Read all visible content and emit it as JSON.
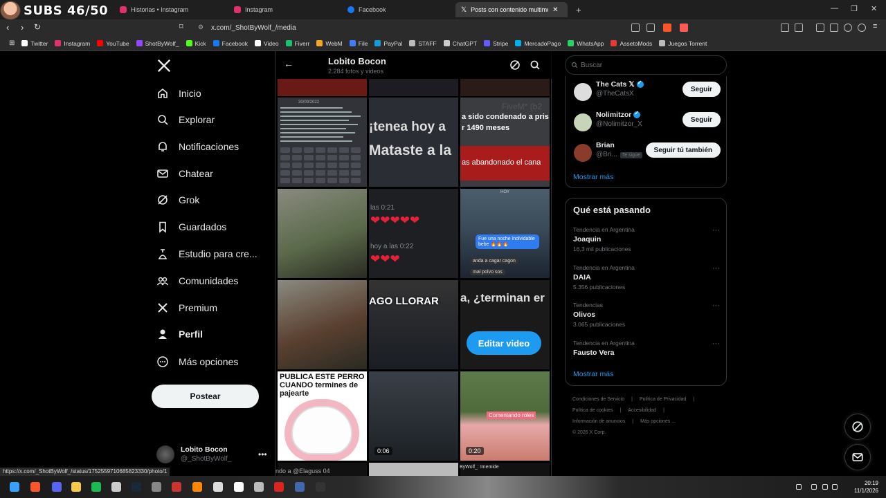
{
  "overlay": {
    "subs": "SUBS 46/50"
  },
  "tabs": [
    {
      "label": "Historias • Instagram",
      "color": "#e1306c"
    },
    {
      "label": "Instagram",
      "color": "#e1306c"
    },
    {
      "label": "Facebook",
      "color": "#1877f2"
    },
    {
      "label": "Posts con contenido multimedia",
      "color": "#ffffff"
    }
  ],
  "address": {
    "url": "x.com/_ShotByWolf_/media"
  },
  "bookmarks": [
    {
      "label": "Twitter",
      "color": "#ffffff"
    },
    {
      "label": "Instagram",
      "color": "#e1306c"
    },
    {
      "label": "YouTube",
      "color": "#ff0000"
    },
    {
      "label": "ShotByWolf_",
      "color": "#9146ff"
    },
    {
      "label": "Kick",
      "color": "#53fc18"
    },
    {
      "label": "Facebook",
      "color": "#1877f2"
    },
    {
      "label": "Video",
      "color": "#ffffff"
    },
    {
      "label": "Fiverr",
      "color": "#1dbf73"
    },
    {
      "label": "WebM",
      "color": "#f5a623"
    },
    {
      "label": "File",
      "color": "#3f7cf6"
    },
    {
      "label": "PayPal",
      "color": "#169bd7"
    },
    {
      "label": "STAFF",
      "color": "#bbbbbb"
    },
    {
      "label": "ChatGPT",
      "color": "#cccccc"
    },
    {
      "label": "Stripe",
      "color": "#635bff"
    },
    {
      "label": "MercadoPago",
      "color": "#00b1ea"
    },
    {
      "label": "WhatsApp",
      "color": "#25d366"
    },
    {
      "label": "AssetoMods",
      "color": "#e53935"
    },
    {
      "label": "Juegos Torrent",
      "color": "#bbbbbb"
    }
  ],
  "nav": {
    "items": [
      {
        "label": "Inicio",
        "icon": "home-icon"
      },
      {
        "label": "Explorar",
        "icon": "search-icon"
      },
      {
        "label": "Notificaciones",
        "icon": "bell-icon"
      },
      {
        "label": "Chatear",
        "icon": "mail-icon"
      },
      {
        "label": "Grok",
        "icon": "grok-icon"
      },
      {
        "label": "Guardados",
        "icon": "bookmark-icon"
      },
      {
        "label": "Estudio para cre...",
        "icon": "studio-icon"
      },
      {
        "label": "Comunidades",
        "icon": "communities-icon"
      },
      {
        "label": "Premium",
        "icon": "x-icon"
      },
      {
        "label": "Perfil",
        "icon": "profile-icon"
      },
      {
        "label": "Más opciones",
        "icon": "more-icon"
      }
    ],
    "post_label": "Postear",
    "account": {
      "name": "Lobito Bocon",
      "handle": "@_ShotByWolf_"
    }
  },
  "main": {
    "title": "Lobito Bocon",
    "subtitle": "2.284 fotos y videos",
    "tiles": [
      {
        "kind": "discord-msg",
        "date": "30/09/2022"
      },
      {
        "kind": "text",
        "text": "¡tenea   hoy a",
        "text2": "Mataste a la"
      },
      {
        "kind": "text-red",
        "text": "a sido condenado a pris",
        "text2": "r 1490 meses",
        "text3": "as abandonado el cana",
        "top": "FiveM* (b2"
      },
      {
        "kind": "photo",
        "bg": "#5a6a4a"
      },
      {
        "kind": "chat",
        "text": "las 0:21",
        "text2": "hoy a las 0:22"
      },
      {
        "kind": "game-chat",
        "bubble": "Fue una noche inolvidable bebe 🔥🔥🔥",
        "l1": "anda a cagar cagon",
        "l2": "mal polvo sos",
        "top": "HOY"
      },
      {
        "kind": "photo",
        "bg": "#5a4030"
      },
      {
        "kind": "caption",
        "text": "AGO LLORAR"
      },
      {
        "kind": "edit",
        "text": "a, ¿terminan er",
        "btn": "Editar video"
      },
      {
        "kind": "meme",
        "text": "PUBLICA ESTE PERRO CUANDO termines de pajearte"
      },
      {
        "kind": "video",
        "duration": "0:06"
      },
      {
        "kind": "tiktok",
        "duration": "0:20",
        "text": "Comentando roles"
      }
    ],
    "bottom_text": "ndo a @Elaguss 04",
    "bottom_text2": "ByWolf_: Imemide"
  },
  "right": {
    "search_placeholder": "Buscar",
    "follows": [
      {
        "name": "The Cats 𝕏",
        "handle": "@TheCatsX",
        "btn": "Seguir",
        "verified": true,
        "color": "#dddddd"
      },
      {
        "name": "Nolimitzor",
        "handle": "@Nolimitzor_X",
        "btn": "Seguir",
        "verified": true,
        "color": "#c8d4b8"
      },
      {
        "name": "Brian",
        "handle": "@Bri...",
        "btn": "Seguir tú también",
        "verified": false,
        "badge": "Te sigue",
        "color": "#8a3c2a"
      }
    ],
    "follows_more": "Mostrar más",
    "trends_title": "Qué está pasando",
    "trends": [
      {
        "context": "Tendencia en Argentina",
        "name": "Joaquin",
        "count": "16,3 mil publicaciones"
      },
      {
        "context": "Tendencia en Argentina",
        "name": "DAIA",
        "count": "5.356 publicaciones"
      },
      {
        "context": "Tendencias",
        "name": "Olivos",
        "count": "3.065 publicaciones"
      },
      {
        "context": "Tendencia en Argentina",
        "name": "Fausto Vera",
        "count": ""
      }
    ],
    "trends_more": "Mostrar más",
    "footer": {
      "l1a": "Condiciones de Servicio",
      "l1b": "Política de Privacidad",
      "l2a": "Política de cookies",
      "l2b": "Accesibilidad",
      "l3a": "Información de anuncios",
      "l3b": "Más opciones ...",
      "l4": "© 2026 X Corp."
    }
  },
  "status_url": "https://x.com/_ShotByWolf_/status/1752559710685823330/photo/1",
  "clock": {
    "time": "20:19",
    "date": "11/1/2026"
  }
}
